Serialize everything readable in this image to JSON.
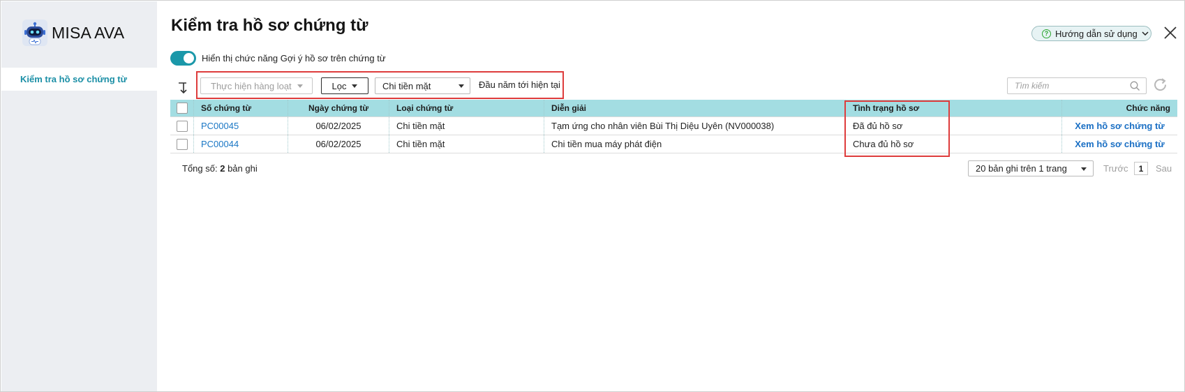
{
  "app": {
    "name": "MISA AVA"
  },
  "sidebar": {
    "items": [
      {
        "label": "Kiểm tra hồ sơ chứng từ",
        "active": true
      }
    ]
  },
  "header": {
    "title": "Kiểm tra hồ sơ chứng từ",
    "help_label": "Hướng dẫn sử dụng"
  },
  "toggle": {
    "label": "Hiển thị chức năng Gợi ý hồ sơ trên chứng từ",
    "on": true
  },
  "toolbar": {
    "bulk_label": "Thực hiện hàng loạt",
    "filter_label": "Lọc",
    "type_select": "Chi tiền mặt",
    "period": "Đầu năm tới hiện tại",
    "search_placeholder": "Tìm kiếm"
  },
  "table": {
    "columns": [
      "Số chứng từ",
      "Ngày chứng từ",
      "Loại chứng từ",
      "Diễn giải",
      "Tình trạng hồ sơ",
      "Chức năng"
    ],
    "rows": [
      {
        "number": "PC00045",
        "date": "06/02/2025",
        "type": "Chi tiền mặt",
        "description": "Tạm ứng cho nhân viên Bùi Thị Diệu Uyên (NV000038)",
        "status": "Đã đủ hồ sơ",
        "action": "Xem hồ sơ chứng từ"
      },
      {
        "number": "PC00044",
        "date": "06/02/2025",
        "type": "Chi tiền mặt",
        "description": "Chi tiền mua máy phát điện",
        "status": "Chưa đủ hồ sơ",
        "action": "Xem hồ sơ chứng từ"
      }
    ]
  },
  "footer": {
    "total_prefix": "Tổng số:",
    "total_count": "2",
    "total_suffix": "bản ghi",
    "page_size": "20 bản ghi trên 1 trang",
    "prev": "Trước",
    "page": "1",
    "next": "Sau"
  },
  "colors": {
    "accent": "#1b98a9",
    "header_bg": "#a3dde2",
    "sidebar_bg": "#eceef2",
    "highlight": "#de3c3c",
    "link": "#1a77c5"
  }
}
